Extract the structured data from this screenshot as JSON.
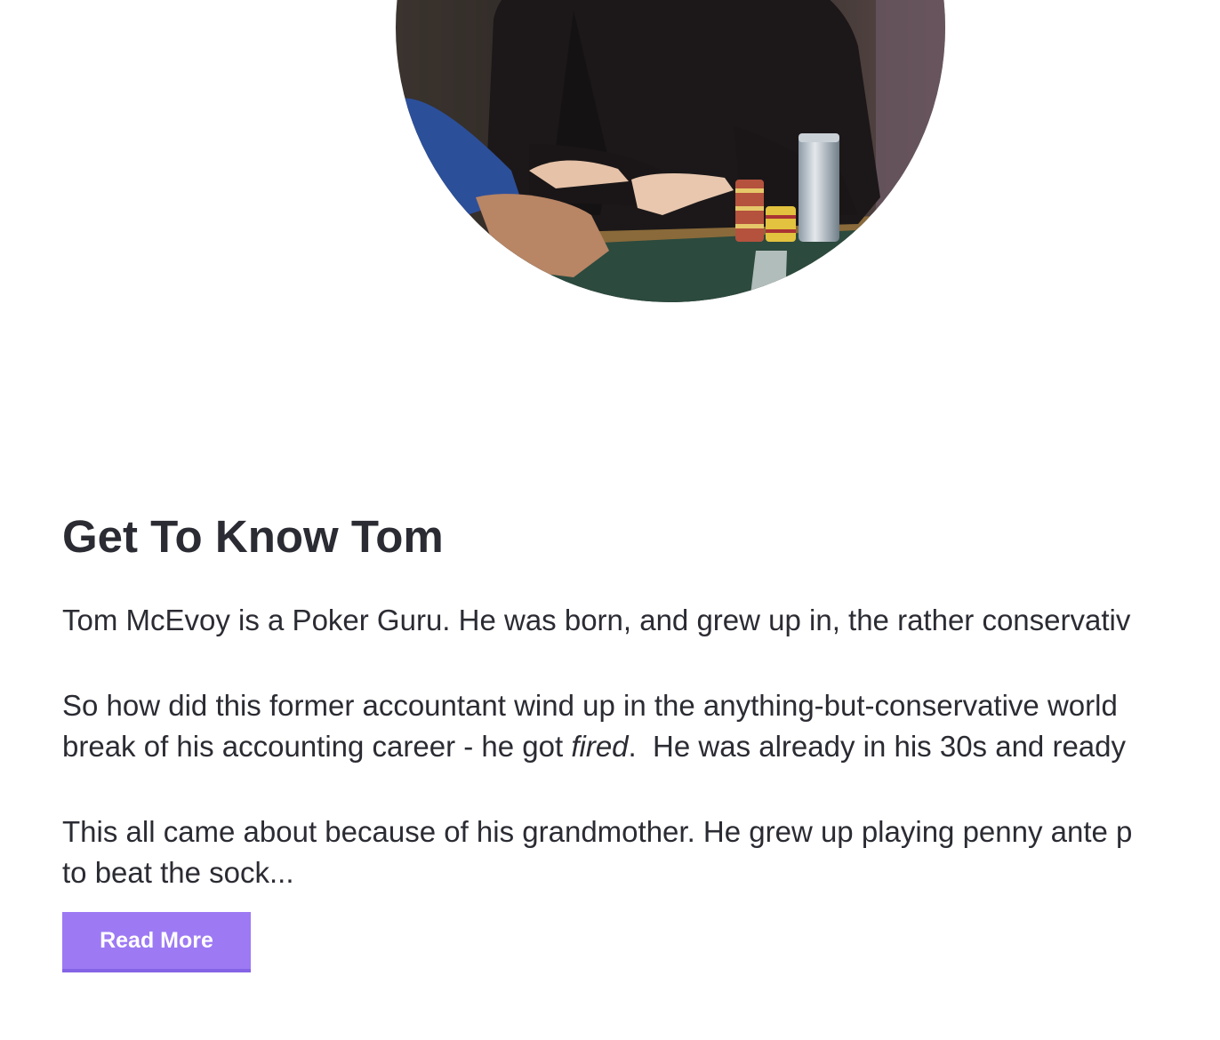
{
  "hero_image": {
    "alt": "Tom McEvoy at a poker table with chip stacks",
    "icon": "portrait-photo"
  },
  "section": {
    "title": "Get To Know Tom",
    "paragraphs": [
      {
        "lines": [
          [
            "Tom McEvoy is a Poker Guru. He was born, and grew up in, the rather conservativ"
          ]
        ]
      },
      {
        "lines": [
          [
            "So how did this former accountant wind up in the anything-but-conservative world"
          ],
          [
            "break of his accounting career - he got ",
            "fired",
            ".  He was already in his 30s and ready"
          ]
        ]
      },
      {
        "lines": [
          [
            "This all came about because of his grandmother. He grew up playing penny ante p"
          ],
          [
            "to beat the sock..."
          ]
        ]
      }
    ],
    "read_more_label": "Read More"
  },
  "colors": {
    "text": "#2b2c33",
    "button_bg": "#9d7af4",
    "button_text": "#ffffff"
  }
}
